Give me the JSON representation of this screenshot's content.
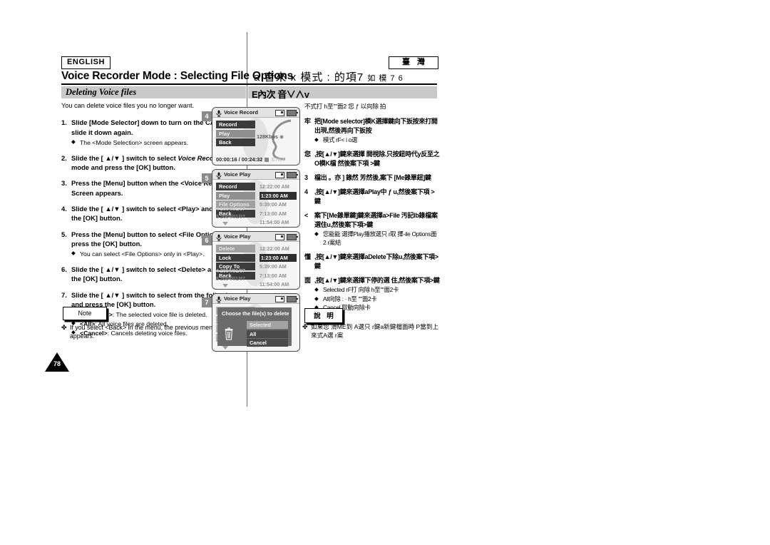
{
  "header": {
    "language_badge": "ENGLISH",
    "region_badge": "臺灣",
    "title_en": "Voice Recorder Mode : Selecting File Options",
    "title_cn": "a 音來 x 模式 : 的項7",
    "title_cn_small": "如 模 7 6"
  },
  "section": {
    "title_en": "Deleting Voice files",
    "title_cn": "E內次 音∨∧v"
  },
  "left": {
    "intro": "You can delete voice files you no longer want.",
    "steps": [
      {
        "num": "1.",
        "text": "Slide [Mode Selector] down to turn on the CAM and slide it down again.",
        "bullets": [
          {
            "mark": "◆",
            "text": "The <Mode Selection> screen appears."
          }
        ]
      },
      {
        "num": "2.",
        "pre": "Slide the [ ▲/▼ ] switch to select ",
        "italic": "Voice Recorder",
        "post": " mode and press the [OK] button.",
        "bullets": []
      },
      {
        "num": "3.",
        "text": "Press the [Menu] button when the <Voice Record> Screen appears.",
        "bullets": []
      },
      {
        "num": "4.",
        "text": "Slide the [ ▲/▼ ] switch to select <Play> and press the [OK] button.",
        "bullets": []
      },
      {
        "num": "5.",
        "text": "Press the [Menu] button to select <File Options> and press the [OK] button.",
        "bullets": [
          {
            "mark": "◆",
            "text": "You can select <File Options> only in <Play>."
          }
        ]
      },
      {
        "num": "6.",
        "text": "Slide the [ ▲/▼ ] switch to select <Delete> and press the [OK] button.",
        "bullets": []
      },
      {
        "num": "7.",
        "text": "Slide the [ ▲/▼ ] switch to select from the following and press the [OK] button.",
        "bullets": [
          {
            "mark": "◆",
            "bold": "<Selected>",
            "text": ": The selected voice file is deleted."
          },
          {
            "mark": "◆",
            "bold": "<All>",
            "text": ": All voice files are deleted."
          },
          {
            "mark": "◆",
            "bold": "<Cancel>",
            "text": ": Cancels deleting voice files."
          }
        ]
      }
    ],
    "note_label": "Note",
    "note_mark": "✤",
    "note_text": "If you select <Back> in the menu, the previous menu appears."
  },
  "shots": [
    {
      "step": "4",
      "title": "Voice Record",
      "menu": [
        {
          "label": "Record",
          "state": "normal"
        },
        {
          "label": "Play",
          "state": "sel"
        },
        {
          "label": "Back",
          "state": "normal"
        }
      ],
      "rec_info": "128Kbps",
      "status_time": "00:00:16 / 00:24:32",
      "status_mode": "STBY"
    },
    {
      "step": "5",
      "title": "Voice Play",
      "menu": [
        {
          "label": "Record",
          "state": "normal"
        },
        {
          "label": "Play",
          "state": "sel"
        },
        {
          "label": "File Options",
          "state": "dim"
        },
        {
          "label": "Back",
          "state": "normal"
        }
      ],
      "times": [
        {
          "value": "12:22:00 AM",
          "hl": false
        },
        {
          "value": "1:23:00 AM",
          "hl": true
        },
        {
          "value": "5:39:00 AM",
          "hl": false
        },
        {
          "value": "7:13:00 AM",
          "hl": false
        },
        {
          "value": "11:54:00 AM",
          "hl": false
        }
      ],
      "file_ghost": "4  2004/01/07",
      "file_row": "5  2004/01/07"
    },
    {
      "step": "6",
      "title": "Voice Play",
      "menu": [
        {
          "label": "Delete",
          "state": "dim"
        },
        {
          "label": "Lock",
          "state": "normal"
        },
        {
          "label": "Copy To",
          "state": "normal"
        },
        {
          "label": "Back",
          "state": "normal"
        }
      ],
      "times": [
        {
          "value": "12:22:00 AM",
          "hl": false
        },
        {
          "value": "1:23:00 AM",
          "hl": true
        },
        {
          "value": "5:39:00 AM",
          "hl": false
        },
        {
          "value": "7:13:00 AM",
          "hl": false
        },
        {
          "value": "11:54:00 AM",
          "hl": false
        }
      ],
      "file_ghost": "4  2004/01/07",
      "file_row": "5  2004/01/07"
    },
    {
      "step": "7",
      "title": "Voice Play",
      "dialog_title": "Choose the file(s) to delete",
      "dialog_options": [
        {
          "label": "Selected",
          "sel": true
        },
        {
          "label": "All",
          "sel": false
        },
        {
          "label": "Cancel",
          "sel": false
        }
      ]
    }
  ],
  "right": {
    "intro": "不式打 h至\"\"面2 您 ƒ 以向除 拍",
    "steps": [
      {
        "num": "牢",
        "text": "把[Mode selector]模K選擇鍵向下扳按來打開出現,然後再向下扳按",
        "bullets": [
          {
            "mark": "◆",
            "text": "模式 rF< i o選"
          }
        ]
      },
      {
        "num": "您",
        "text": ",按[▲/▼]鍵來選擇 開視除.只按鈕時代y反至之O模K檔 然後案下項 >鍵",
        "bullets": []
      },
      {
        "num": "3",
        "text": "檔出 。亦 ] 錄然 芳然後,案下 [Me錄單鈕]鍵",
        "bullets": []
      },
      {
        "num": "4",
        "text": ",按[▲/▼]鍵來選擇aPlay中 ƒ u,然後案下項 > 鍵",
        "bullets": []
      },
      {
        "num": "<",
        "text": "案下[Me錄單鍵]鍵來選擇a>File 汚記lb錄檔案選住u,然後案下項>鍵",
        "bullets": [
          {
            "mark": "◆",
            "text": "您能能 選擇Play播放選只 r取 擇-ile Options面 2 r案結"
          }
        ]
      },
      {
        "num": "懂",
        "text": ",按[▲/▼]鍵來選擇aDelete下除u,然後案下項>鍵",
        "bullets": []
      },
      {
        "num": "面",
        "text": ",按[▲/▼]鍵來選擇下停的選 住,然後案下項>鍵",
        "bullets": [
          {
            "mark": "◆",
            "text": "Selected rF打 向除 h至\"\"面2卡"
          },
          {
            "mark": "◆",
            "text": "All向除 : · h至 \"\"面2卡"
          },
          {
            "mark": "◆",
            "text": "Cancel 取動向除卡"
          }
        ]
      }
    ],
    "note_label": "說 明",
    "note_mark": "✤",
    "note_text": "如果您 滑ME到 A選只 r鍵a新鍵檔面時 P當到上來式A選 r案"
  }
}
